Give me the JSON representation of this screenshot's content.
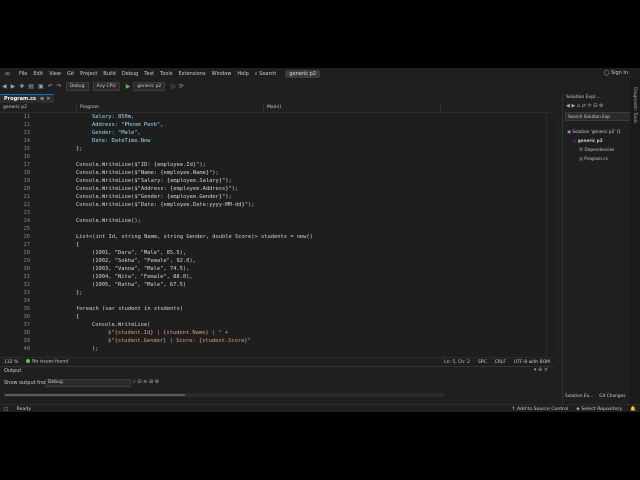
{
  "menu": [
    "File",
    "Edit",
    "View",
    "Git",
    "Project",
    "Build",
    "Debug",
    "Test",
    "Tools",
    "Extensions",
    "Window",
    "Help"
  ],
  "search_label": "Search",
  "project_name": "generic p2",
  "sign_in": "Sign in",
  "toolbar": {
    "config": "Debug",
    "platform": "Any CPU",
    "run_target": "generic p2"
  },
  "tabs": {
    "file_tab": "Program.cs"
  },
  "nav": {
    "project": "generic p2",
    "class": "Program",
    "member": "Main()"
  },
  "editor": {
    "lines": [
      {
        "n": "11",
        "code": "Salary: 850m,"
      },
      {
        "n": "12",
        "code": "Address: \"Phnom Penh\","
      },
      {
        "n": "13",
        "code": "Gender: \"Male\","
      },
      {
        "n": "14",
        "code": "Date: DateTime.Now"
      },
      {
        "n": "15",
        "code": "};"
      },
      {
        "n": "16",
        "code": ""
      },
      {
        "n": "17",
        "code": "Console.WriteLine($\"ID: {employee.Id}\");"
      },
      {
        "n": "18",
        "code": "Console.WriteLine($\"Name: {employee.Name}\");"
      },
      {
        "n": "19",
        "code": "Console.WriteLine($\"Salary: {employee.Salary}\");"
      },
      {
        "n": "20",
        "code": "Console.WriteLine($\"Address: {employee.Address}\");"
      },
      {
        "n": "21",
        "code": "Console.WriteLine($\"Gender: {employee.Gender}\");"
      },
      {
        "n": "22",
        "code": "Console.WriteLine($\"Date: {employee.Date:yyyy-MM-dd}\");"
      },
      {
        "n": "23",
        "code": ""
      },
      {
        "n": "24",
        "code": "Console.WriteLine();"
      },
      {
        "n": "25",
        "code": ""
      },
      {
        "n": "26",
        "code": "List<(int Id, string Name, string Gender, double Score)> students = new()"
      },
      {
        "n": "27",
        "code": "{"
      },
      {
        "n": "28",
        "code": "(1001, \"Dara\", \"Male\", 85.5),"
      },
      {
        "n": "29",
        "code": "(1002, \"Sokha\", \"Female\", 92.0),"
      },
      {
        "n": "30",
        "code": "(1003, \"Vanna\", \"Male\", 74.5),"
      },
      {
        "n": "31",
        "code": "(1004, \"Nita\", \"Female\", 88.0),"
      },
      {
        "n": "32",
        "code": "(1005, \"Ratha\", \"Male\", 67.5)"
      },
      {
        "n": "33",
        "code": "};"
      },
      {
        "n": "34",
        "code": ""
      },
      {
        "n": "35",
        "code": "foreach (var student in students)"
      },
      {
        "n": "36",
        "code": "{"
      },
      {
        "n": "37",
        "code": "Console.WriteLine("
      },
      {
        "n": "38",
        "code": "$\"{student.Id} | {student.Name} | \" +"
      },
      {
        "n": "39",
        "code": "$\"{student.Gender} | Score: {student.Score}\""
      },
      {
        "n": "40",
        "code": ");"
      }
    ]
  },
  "editor_status": {
    "zoom": "132 %",
    "issues": "No issues found",
    "position": "Ln: 5, Ch: 2",
    "spc": "SPC",
    "crlf": "CRLF",
    "encoding": "UTF-8 with BOM"
  },
  "output": {
    "title": "Output",
    "show_from_label": "Show output from:",
    "source": "Debug"
  },
  "solution_explorer": {
    "title": "Solution Expl...",
    "search_placeholder": "Search Solution Exp",
    "solution": "Solution 'generic p2' (1",
    "project": "generic p2",
    "dependencies": "Dependencies",
    "file": "Program.cs",
    "tab1": "Solution Ex...",
    "tab2": "Git Changes"
  },
  "diag_tools": "Diagnostic Tools",
  "status": {
    "ready": "Ready",
    "add_source": "Add to Source Control",
    "select_repo": "Select Repository"
  },
  "colors": {
    "accent": "#0e70c0",
    "keyword": "#569cd6",
    "type": "#4ec9b0",
    "method": "#dcdcaa",
    "string": "#d69d85",
    "number": "#b5cea8"
  }
}
